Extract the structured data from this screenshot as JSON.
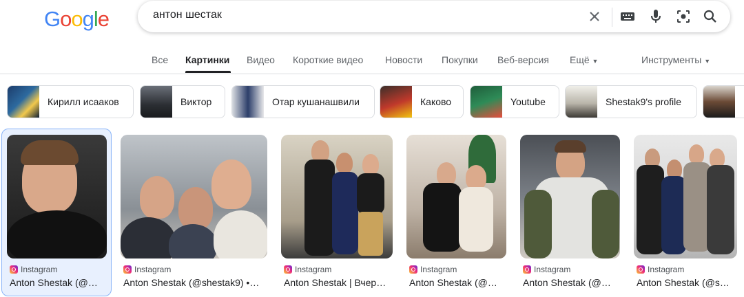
{
  "logo": {
    "letters": [
      "G",
      "o",
      "o",
      "g",
      "l",
      "e"
    ]
  },
  "search": {
    "query": "антон шестак"
  },
  "tabs": [
    {
      "label": "Все"
    },
    {
      "label": "Картинки"
    },
    {
      "label": "Видео"
    },
    {
      "label": "Короткие видео"
    },
    {
      "label": "Новости"
    },
    {
      "label": "Покупки"
    },
    {
      "label": "Веб-версия"
    },
    {
      "label": "Ещё"
    }
  ],
  "tools_label": "Инструменты",
  "chips": [
    {
      "label": "Кирилл исааков"
    },
    {
      "label": "Виктор"
    },
    {
      "label": "Отар кушанашвили"
    },
    {
      "label": "Каково"
    },
    {
      "label": "Youtube"
    },
    {
      "label": "Shestak9's profile"
    }
  ],
  "results": [
    {
      "source": "Instagram",
      "title": "Anton Shestak (@…"
    },
    {
      "source": "Instagram",
      "title": "Anton Shestak (@shestak9) •…"
    },
    {
      "source": "Instagram",
      "title": "Anton Shestak | Вчер…"
    },
    {
      "source": "Instagram",
      "title": "Anton Shestak (@…"
    },
    {
      "source": "Instagram",
      "title": "Anton Shestak (@…"
    },
    {
      "source": "Instagram",
      "title": "Anton Shestak (@s…"
    }
  ],
  "colors": {
    "google_blue": "#4285f4",
    "google_red": "#ea4335",
    "google_yellow": "#fbbc05",
    "google_green": "#34a853"
  }
}
